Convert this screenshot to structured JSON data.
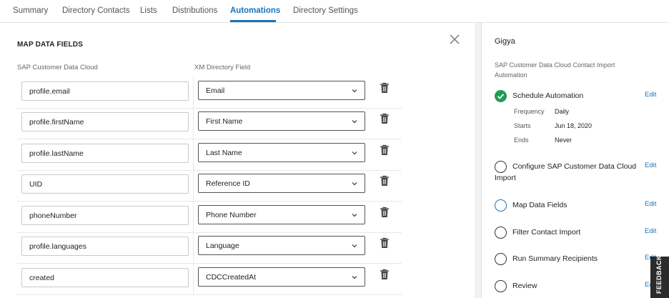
{
  "tabs": [
    {
      "label": "Summary"
    },
    {
      "label": "Directory Contacts"
    },
    {
      "label": "Lists"
    },
    {
      "label": "Distributions"
    },
    {
      "label": "Automations"
    },
    {
      "label": "Directory Settings"
    }
  ],
  "active_tab": "Automations",
  "main": {
    "title": "MAP DATA FIELDS",
    "col_source": "SAP Customer Data Cloud",
    "col_target": "XM Directory Field",
    "rows": [
      {
        "source": "profile.email",
        "target": "Email"
      },
      {
        "source": "profile.firstName",
        "target": "First Name"
      },
      {
        "source": "profile.lastName",
        "target": "Last Name"
      },
      {
        "source": "UID",
        "target": "Reference ID"
      },
      {
        "source": "phoneNumber",
        "target": "Phone Number"
      },
      {
        "source": "profile.languages",
        "target": "Language"
      },
      {
        "source": "created",
        "target": "CDCCreatedAt"
      }
    ]
  },
  "sidebar": {
    "title": "Gigya",
    "subtitle": "SAP Customer Data Cloud Contact Import Automation",
    "edit_label": "Edit",
    "steps": [
      {
        "label": "Schedule Automation",
        "status": "done",
        "details": [
          {
            "key": "Frequency",
            "value": "Daily"
          },
          {
            "key": "Starts",
            "value": "Jun 18, 2020"
          },
          {
            "key": "Ends",
            "value": "Never"
          }
        ]
      },
      {
        "label": "Configure SAP Customer Data Cloud Import",
        "status": "empty"
      },
      {
        "label": "Map Data Fields",
        "status": "active"
      },
      {
        "label": "Filter Contact Import",
        "status": "empty"
      },
      {
        "label": "Run Summary Recipients",
        "status": "empty"
      },
      {
        "label": "Review",
        "status": "empty"
      }
    ]
  },
  "feedback_label": "FEEDBACK",
  "colors": {
    "accent": "#1a73b8",
    "success": "#1f9d55"
  }
}
